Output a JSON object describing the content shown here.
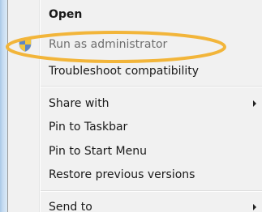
{
  "context_menu": {
    "items": [
      {
        "label": "Open",
        "bold": true,
        "disabled": false,
        "submenu": false,
        "icon": null
      },
      {
        "label": "Run as administrator",
        "bold": false,
        "disabled": true,
        "submenu": false,
        "icon": "uac-shield-icon"
      },
      {
        "label": "Troubleshoot compatibility",
        "bold": false,
        "disabled": false,
        "submenu": false,
        "icon": null
      },
      {
        "label": "Share with",
        "bold": false,
        "disabled": false,
        "submenu": true,
        "icon": null
      },
      {
        "label": "Pin to Taskbar",
        "bold": false,
        "disabled": false,
        "submenu": false,
        "icon": null
      },
      {
        "label": "Pin to Start Menu",
        "bold": false,
        "disabled": false,
        "submenu": false,
        "icon": null
      },
      {
        "label": "Restore previous versions",
        "bold": false,
        "disabled": false,
        "submenu": false,
        "icon": null
      },
      {
        "label": "Send to",
        "bold": false,
        "disabled": false,
        "submenu": true,
        "icon": null
      }
    ]
  },
  "annotation": {
    "shape": "ellipse",
    "color": "#f2b53a",
    "target": "Run as administrator"
  },
  "colors": {
    "menu_background": "#f1f1f1",
    "text": "#1a1a1a",
    "disabled_text": "#6d6d6d",
    "frame_edge": "#a9c8e6"
  }
}
